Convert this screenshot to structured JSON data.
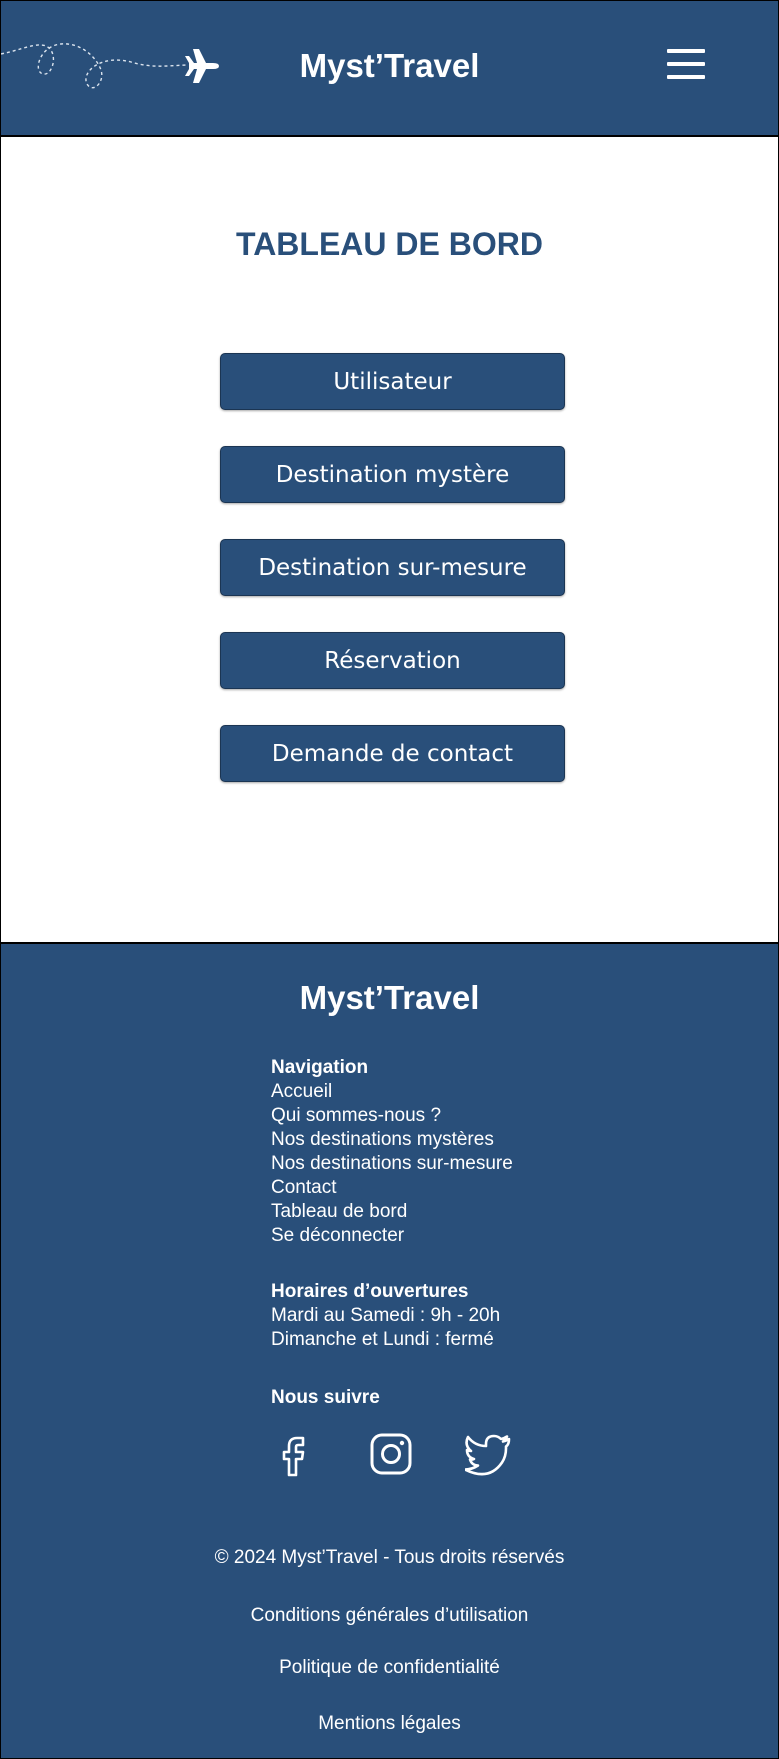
{
  "header": {
    "brand": "Myst’Travel",
    "menu_icon": "hamburger-menu-icon",
    "plane_icon": "airplane-icon"
  },
  "main": {
    "title": "TABLEAU DE BORD",
    "buttons": [
      {
        "label": "Utilisateur"
      },
      {
        "label": "Destination mystère"
      },
      {
        "label": "Destination sur-mesure"
      },
      {
        "label": "Réservation"
      },
      {
        "label": "Demande de contact"
      }
    ]
  },
  "footer": {
    "brand": "Myst’Travel",
    "navigation": {
      "heading": "Navigation",
      "links": [
        "Accueil",
        "Qui sommes-nous ?",
        "Nos destinations mystères",
        "Nos destinations sur-mesure",
        "Contact",
        "Tableau de bord",
        "Se déconnecter"
      ]
    },
    "hours": {
      "heading": "Horaires d’ouvertures",
      "lines": [
        "Mardi au Samedi : 9h - 20h",
        "Dimanche et Lundi : fermé"
      ]
    },
    "social": {
      "heading": "Nous suivre",
      "icons": [
        "facebook-icon",
        "instagram-icon",
        "twitter-icon"
      ]
    },
    "copyright": "© 2024 Myst’Travel - Tous droits réservés",
    "legal_links": [
      "Conditions générales d’utilisation",
      "Politique de confidentialité",
      "Mentions légales"
    ]
  },
  "colors": {
    "primary": "#294f7a",
    "background": "#ffffff",
    "text_on_primary": "#ffffff"
  }
}
